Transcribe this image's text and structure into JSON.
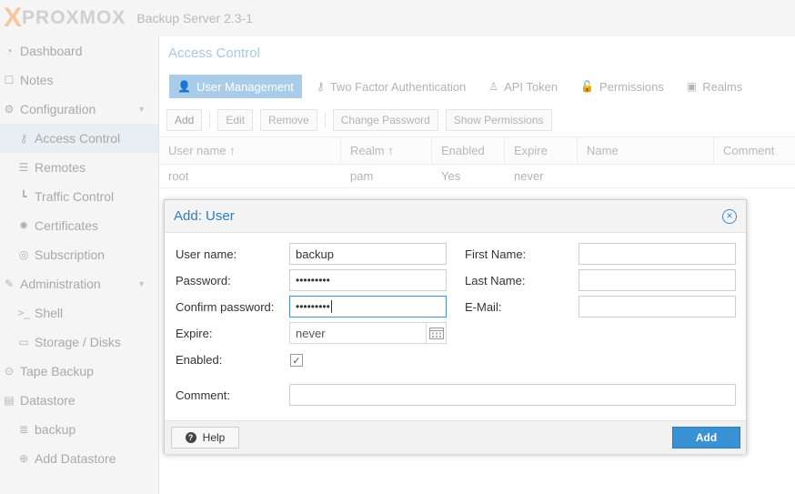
{
  "header": {
    "logo_x": "X",
    "logo_text": "PROXMOX",
    "product": "Backup Server 2.3-1"
  },
  "sidebar": {
    "items": [
      {
        "label": "Dashboard",
        "icon": "dashboard-icon"
      },
      {
        "label": "Notes",
        "icon": "notes-icon"
      },
      {
        "label": "Configuration",
        "icon": "gears-icon"
      },
      {
        "label": "Access Control",
        "icon": "key-icon"
      },
      {
        "label": "Remotes",
        "icon": "server-icon"
      },
      {
        "label": "Traffic Control",
        "icon": "chart-icon"
      },
      {
        "label": "Certificates",
        "icon": "certificate-icon"
      },
      {
        "label": "Subscription",
        "icon": "support-icon"
      },
      {
        "label": "Administration",
        "icon": "wrench-icon"
      },
      {
        "label": "Shell",
        "icon": "terminal-icon"
      },
      {
        "label": "Storage / Disks",
        "icon": "hdd-icon"
      },
      {
        "label": "Tape Backup",
        "icon": "tape-icon"
      },
      {
        "label": "Datastore",
        "icon": "archive-icon"
      },
      {
        "label": "backup",
        "icon": "database-icon"
      },
      {
        "label": "Add Datastore",
        "icon": "plus-circle-icon"
      }
    ]
  },
  "main": {
    "title": "Access Control",
    "tabs": [
      {
        "label": "User Management",
        "icon": "user-icon"
      },
      {
        "label": "Two Factor Authentication",
        "icon": "key-icon"
      },
      {
        "label": "API Token",
        "icon": "user-o-icon"
      },
      {
        "label": "Permissions",
        "icon": "unlock-icon"
      },
      {
        "label": "Realms",
        "icon": "address-book-icon"
      }
    ],
    "toolbar": [
      "Add",
      "Edit",
      "Remove",
      "Change Password",
      "Show Permissions"
    ],
    "grid": {
      "columns": [
        "User name ↑",
        "Realm ↑",
        "Enabled",
        "Expire",
        "Name",
        "Comment"
      ],
      "rows": [
        [
          "root",
          "pam",
          "Yes",
          "never",
          "",
          ""
        ]
      ]
    }
  },
  "dialog": {
    "title": "Add: User",
    "labels": {
      "username": "User name:",
      "password": "Password:",
      "confirm": "Confirm password:",
      "expire": "Expire:",
      "enabled": "Enabled:",
      "comment": "Comment:",
      "firstname": "First Name:",
      "lastname": "Last Name:",
      "email": "E-Mail:"
    },
    "values": {
      "username": "backup",
      "password": "•••••••••",
      "confirm": "•••••••••",
      "expire": "never",
      "enabled": true,
      "comment": "",
      "firstname": "",
      "lastname": "",
      "email": ""
    },
    "help_label": "Help",
    "add_label": "Add"
  },
  "colors": {
    "accent": "#3892d3",
    "title_blue": "#2e7bbf",
    "tab_active": "#a9cde9"
  }
}
